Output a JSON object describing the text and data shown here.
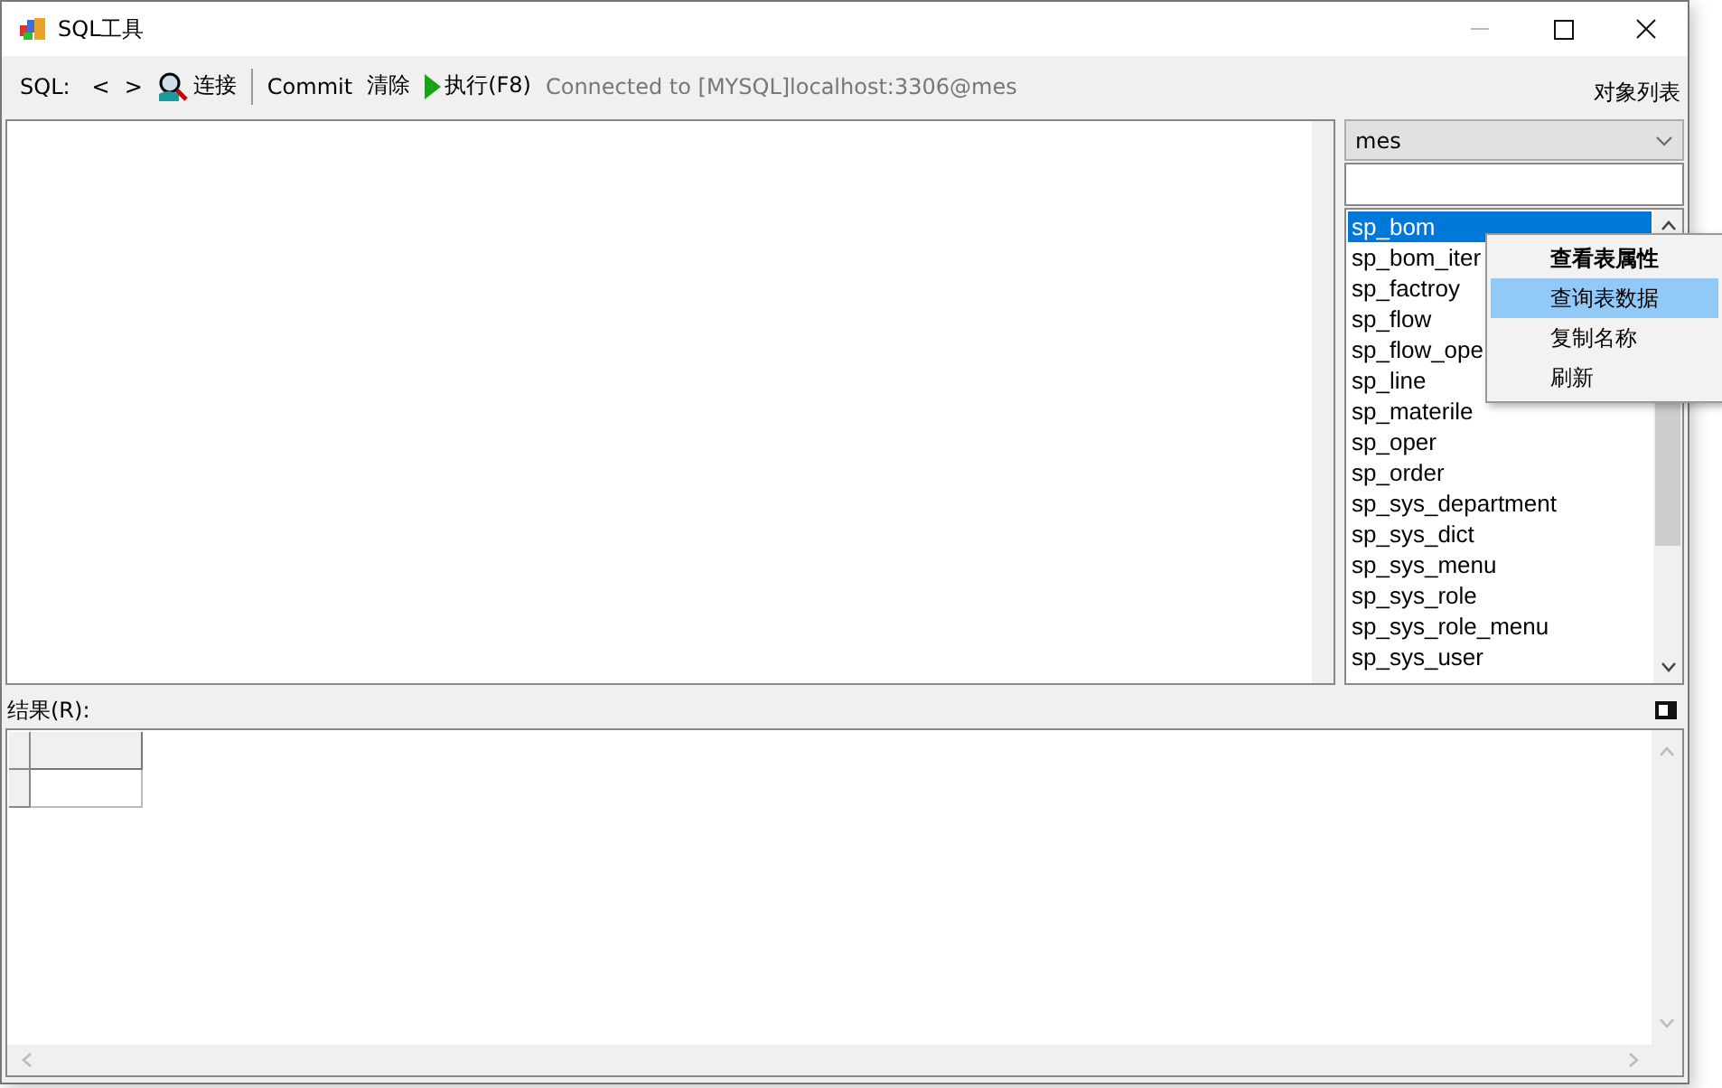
{
  "window": {
    "title": "SQL工具"
  },
  "toolbar": {
    "sql_label": "SQL:",
    "prev": "<",
    "next": ">",
    "connect": "连接",
    "commit": "Commit",
    "clear": "清除",
    "execute": "执行(F8)",
    "status": "Connected to [MYSQL]localhost:3306@mes",
    "object_list": "对象列表"
  },
  "object_panel": {
    "database": "mes",
    "tables": [
      {
        "name": "sp_bom",
        "selected": true
      },
      {
        "name": "sp_bom_iter",
        "selected": false
      },
      {
        "name": "sp_factroy",
        "selected": false
      },
      {
        "name": "sp_flow",
        "selected": false
      },
      {
        "name": "sp_flow_ope",
        "selected": false
      },
      {
        "name": "sp_line",
        "selected": false
      },
      {
        "name": "sp_materile",
        "selected": false
      },
      {
        "name": "sp_oper",
        "selected": false
      },
      {
        "name": "sp_order",
        "selected": false
      },
      {
        "name": "sp_sys_department",
        "selected": false
      },
      {
        "name": "sp_sys_dict",
        "selected": false
      },
      {
        "name": "sp_sys_menu",
        "selected": false
      },
      {
        "name": "sp_sys_role",
        "selected": false
      },
      {
        "name": "sp_sys_role_menu",
        "selected": false
      },
      {
        "name": "sp_sys_user",
        "selected": false
      }
    ]
  },
  "context_menu": [
    {
      "label": "查看表属性",
      "bold": true,
      "selected": false
    },
    {
      "label": "查询表数据",
      "bold": false,
      "selected": true
    },
    {
      "label": "复制名称",
      "bold": false,
      "selected": false
    },
    {
      "label": "刷新",
      "bold": false,
      "selected": false
    }
  ],
  "results": {
    "label": "结果(R):"
  }
}
